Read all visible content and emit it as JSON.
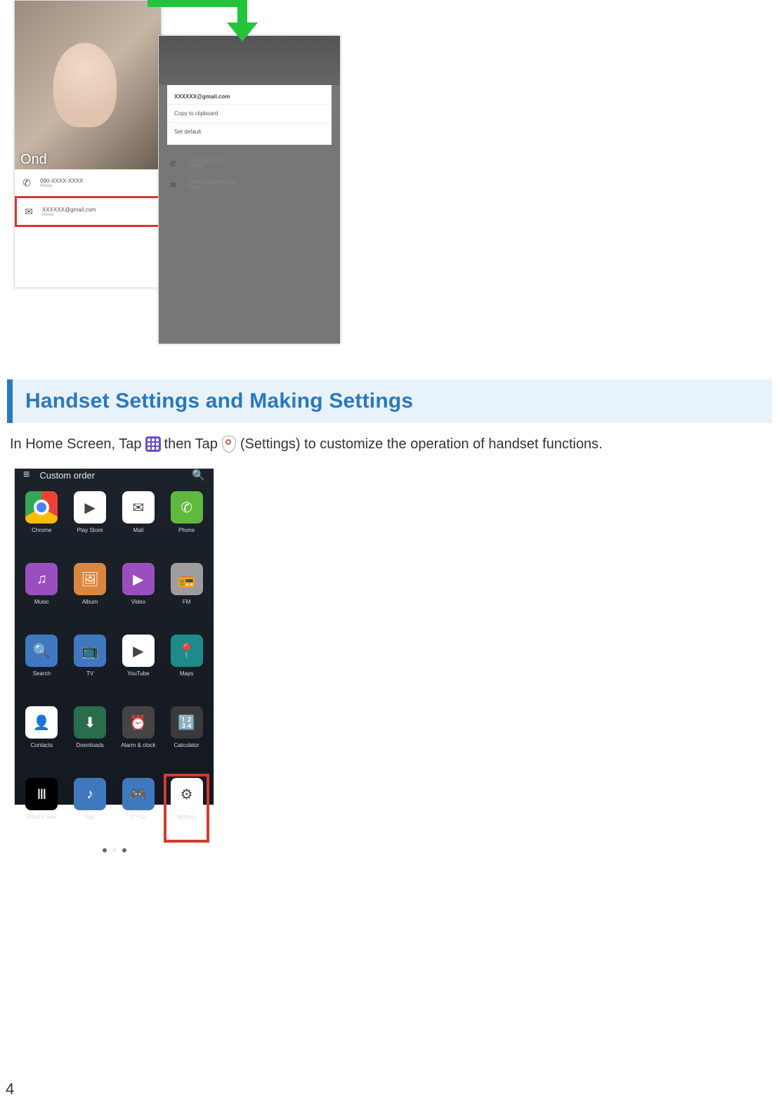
{
  "figure_top": {
    "contact_name": "Ond",
    "left_rows": [
      {
        "icon": "phone",
        "primary": "090-XXXX-XXXX",
        "secondary": "Phone",
        "highlight": false
      },
      {
        "icon": "mail",
        "primary": "XXXXXX@gmail.com",
        "secondary": "Home",
        "highlight": true
      }
    ],
    "popup": {
      "title": "XXXXXX@gmail.com",
      "items": [
        "Copy to clipboard",
        "Set default"
      ]
    },
    "right_rows": [
      {
        "icon": "phone",
        "primary": "090-XXXX-XXXX",
        "secondary": "Phone"
      },
      {
        "icon": "mail",
        "primary": "XXXXXX@gmail.com",
        "secondary": "Home"
      }
    ]
  },
  "section": {
    "heading": "Handset Settings and Making Settings",
    "para_before_apps": "In Home Screen, Tap",
    "para_mid": "then Tap",
    "para_after_settings": "(Settings) to customize the operation of handset functions."
  },
  "drawer": {
    "topbar_title": "Custom order",
    "apps": [
      {
        "label": "Chrome",
        "ico_class": "c-chrome",
        "glyph": ""
      },
      {
        "label": "Play Store",
        "ico_class": "c-play",
        "glyph": "▶"
      },
      {
        "label": "Mail",
        "ico_class": "c-mail",
        "glyph": "✉"
      },
      {
        "label": "Phone",
        "ico_class": "c-phone",
        "glyph": "✆"
      },
      {
        "label": "Music",
        "ico_class": "c-purple",
        "glyph": "♫"
      },
      {
        "label": "Album",
        "ico_class": "c-darkorange",
        "glyph": "🖼"
      },
      {
        "label": "Video",
        "ico_class": "c-purple",
        "glyph": "▶"
      },
      {
        "label": "FM",
        "ico_class": "c-gray",
        "glyph": "📻"
      },
      {
        "label": "Search",
        "ico_class": "c-blue",
        "glyph": "🔍"
      },
      {
        "label": "TV",
        "ico_class": "c-blue",
        "glyph": "📺"
      },
      {
        "label": "YouTube",
        "ico_class": "c-yt",
        "glyph": "▶"
      },
      {
        "label": "Maps",
        "ico_class": "c-teal",
        "glyph": "📍"
      },
      {
        "label": "Contacts",
        "ico_class": "c-contacts",
        "glyph": "👤"
      },
      {
        "label": "Downloads",
        "ico_class": "c-dl",
        "glyph": "⬇"
      },
      {
        "label": "Alarm & clock",
        "ico_class": "c-clock",
        "glyph": "⏰"
      },
      {
        "label": "Calculator",
        "ico_class": "c-calc",
        "glyph": "🔢"
      },
      {
        "label": "What's New",
        "ico_class": "c-black",
        "glyph": "Ⅲ"
      },
      {
        "label": "App",
        "ico_class": "c-blue",
        "glyph": "♪"
      },
      {
        "label": "ゲーム",
        "ico_class": "c-blue",
        "glyph": "🎮"
      },
      {
        "label": "Settings",
        "ico_class": "c-settings",
        "glyph": "⚙",
        "highlight": true
      }
    ]
  },
  "page_number": "4"
}
